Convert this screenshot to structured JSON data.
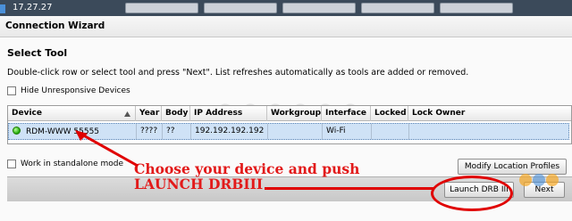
{
  "app": {
    "version": "17.27.27",
    "window_title": "Connection Wizard"
  },
  "page": {
    "heading": "Select Tool",
    "instructions": "Double-click row or select tool and press \"Next\".  List refreshes automatically as tools are added or removed."
  },
  "options": {
    "hide_unresponsive": "Hide Unresponsive Devices",
    "standalone_mode": "Work in standalone mode"
  },
  "table": {
    "headers": [
      "Device",
      "Year",
      "Body",
      "IP Address",
      "Workgroup",
      "Interface",
      "Locked",
      "Lock Owner"
    ],
    "rows": [
      {
        "device": "RDM-WWW 55555",
        "year": "????",
        "body": "??",
        "ip": "192.192.192.192",
        "workgroup": "",
        "interface": "Wi-Fi",
        "locked": "",
        "lock_owner": "",
        "status_color": "#1fa800"
      }
    ]
  },
  "buttons": {
    "modify_profiles": "Modify Location Profiles",
    "launch": "Launch DRB III",
    "next": "Next"
  },
  "annotation": {
    "line1": "Choose your device and push",
    "line2": "LAUNCH DRBIII",
    "color": "#e00000"
  }
}
